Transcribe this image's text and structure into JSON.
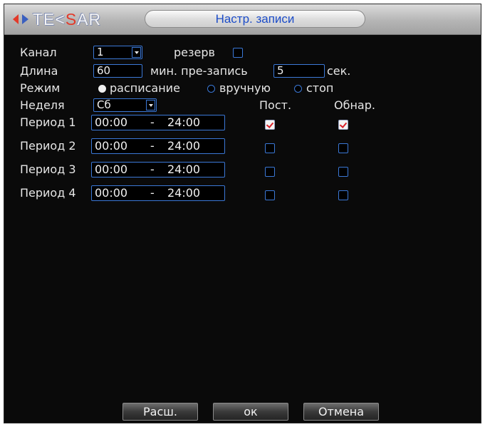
{
  "header": {
    "logo_text_1": "TE",
    "logo_text_accent": "S",
    "logo_text_2": "AR",
    "title": "Настр. записи"
  },
  "form": {
    "channel_label": "Канал",
    "channel_value": "1",
    "reserve_label": "резерв",
    "reserve_checked": false,
    "length_label": "Длина",
    "length_value": "60",
    "prerecord_label": "мин. пре-запись",
    "prerecord_value": "5",
    "prerecord_unit": "сек.",
    "mode_label": "Режим",
    "mode_options": [
      "расписание",
      "вручную",
      "стоп"
    ],
    "mode_selected": "расписание",
    "week_label": "Неделя",
    "week_value": "Сб",
    "col_constant": "Пост.",
    "col_detect": "Обнар."
  },
  "periods": [
    {
      "label": "Период 1",
      "start": "00:00",
      "separator": "-",
      "end": "24:00",
      "constant": true,
      "detect": true
    },
    {
      "label": "Период 2",
      "start": "00:00",
      "separator": "-",
      "end": "24:00",
      "constant": false,
      "detect": false
    },
    {
      "label": "Период 3",
      "start": "00:00",
      "separator": "-",
      "end": "24:00",
      "constant": false,
      "detect": false
    },
    {
      "label": "Период 4",
      "start": "00:00",
      "separator": "-",
      "end": "24:00",
      "constant": false,
      "detect": false
    }
  ],
  "buttons": {
    "advanced": "Расш.",
    "ok": "ок",
    "cancel": "Отмена"
  },
  "colors": {
    "accent_blue": "#3b78d6",
    "title_text": "#1d4dc8",
    "check_mark": "#d8202a"
  }
}
